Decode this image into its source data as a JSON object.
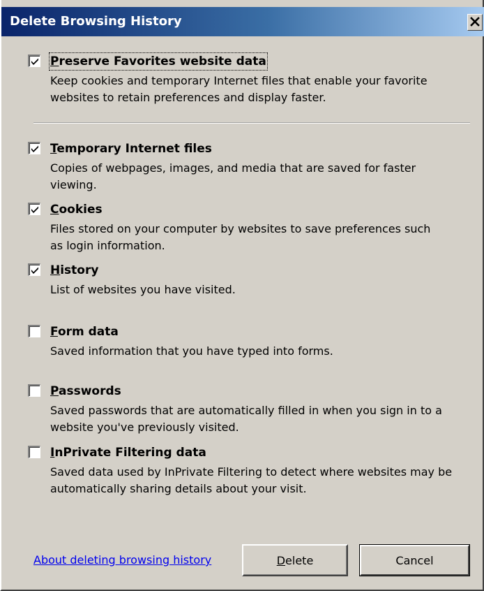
{
  "window": {
    "title": "Delete Browsing History"
  },
  "options": [
    {
      "id": "preserve-favorites",
      "label_access_key": "P",
      "label_rest": "reserve Favorites website data",
      "description": "Keep cookies and temporary Internet files that enable your favorite websites to retain preferences and display faster.",
      "checked": true
    },
    {
      "id": "temporary-internet-files",
      "label_access_key": "T",
      "label_rest": "emporary Internet files",
      "description": "Copies of webpages, images, and media that are saved for faster viewing.",
      "checked": true
    },
    {
      "id": "cookies",
      "label_access_key": "C",
      "label_rest": "ookies",
      "description": "Files stored on your computer by websites to save preferences such as login information.",
      "checked": true
    },
    {
      "id": "history",
      "label_access_key": "H",
      "label_rest": "istory",
      "description": "List of websites you have visited.",
      "checked": true
    },
    {
      "id": "form-data",
      "label_access_key": "F",
      "label_rest": "orm data",
      "description": "Saved information that you have typed into forms.",
      "checked": false
    },
    {
      "id": "passwords",
      "label_access_key": "P",
      "label_rest": "asswords",
      "description": "Saved passwords that are automatically filled in when you sign in to a website you've previously visited.",
      "checked": false
    },
    {
      "id": "inprivate-filtering-data",
      "label_access_key": "I",
      "label_rest": "nPrivate Filtering data",
      "description": "Saved data used by InPrivate Filtering to detect where websites may be automatically sharing details about your visit.",
      "checked": false
    }
  ],
  "footer": {
    "link_label": "About deleting browsing history",
    "delete_access_key": "D",
    "delete_rest": "elete",
    "cancel_label": "Cancel"
  },
  "colors": {
    "dialog_face": "#d4d0c8",
    "title_start": "#0a246a",
    "title_end": "#a6caf0",
    "link": "#0000ee"
  }
}
